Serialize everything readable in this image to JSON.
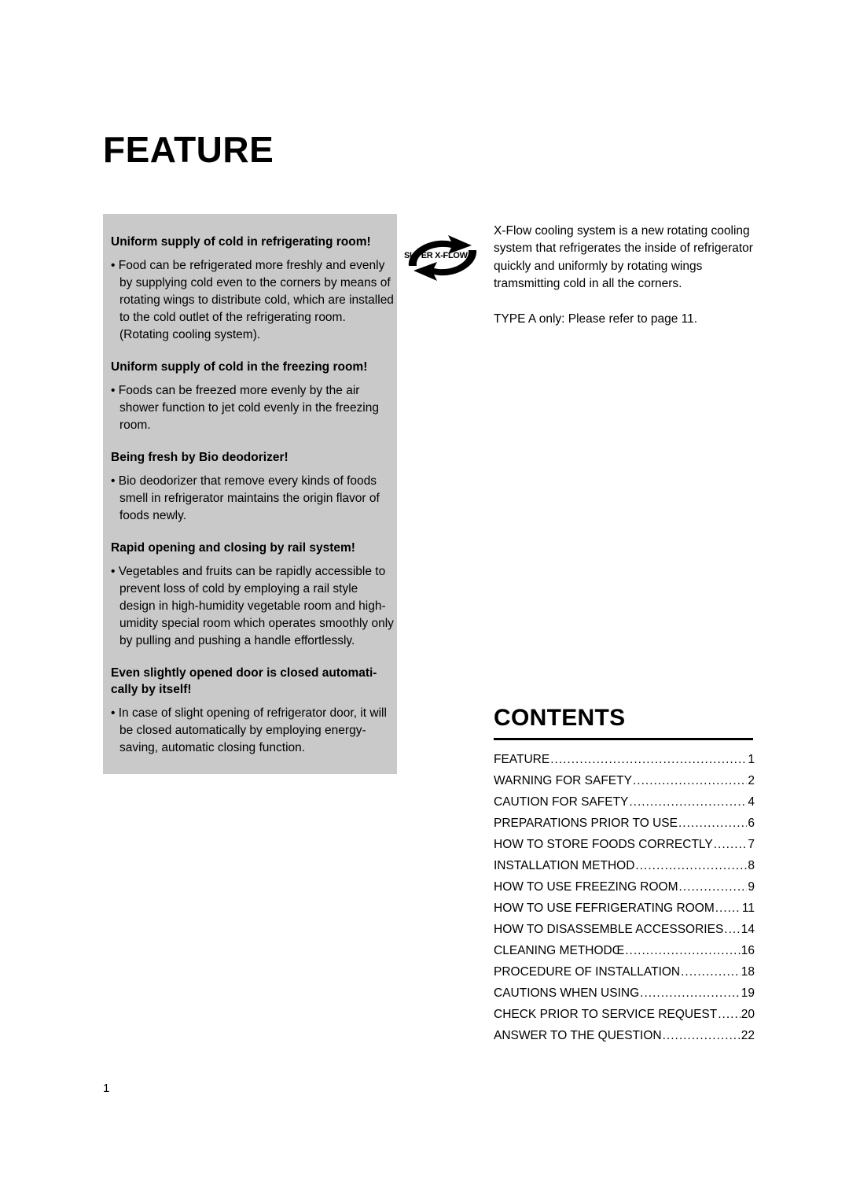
{
  "page": {
    "title": "FEATURE",
    "folio": "1"
  },
  "features": {
    "blocks": [
      {
        "heading": "Uniform supply of cold in refrigerating room!",
        "bullets": [
          "Food can be refrigerated more freshly and evenly by supplying cold even to the corners by means of rotating wings to distribute cold, which are installed to the cold outlet of the refrigerating room. (Rotating cooling system)."
        ]
      },
      {
        "heading": "Uniform supply of cold in the freezing room!",
        "bullets": [
          "Foods can be freezed more evenly by the air shower function to jet cold evenly in the freezing room."
        ]
      },
      {
        "heading": "Being fresh by Bio deodorizer!",
        "bullets": [
          "Bio deodorizer that remove every kinds of foods smell in refrigerator maintains the origin flavor of foods newly."
        ]
      },
      {
        "heading": "Rapid opening and closing by rail system!",
        "bullets": [
          "Vegetables and fruits can be rapidly accessible to prevent loss of cold by employing a rail style design in high-humidity vegetable room and high-umidity special room which operates smoothly only by pulling and pushing a handle effortlessly."
        ]
      },
      {
        "heading": "Even slightly opened door is closed automati- cally by itself!",
        "bullets": [
          "In case of slight opening of refrigerator door, it will be closed automatically by employing energy-saving, automatic closing function."
        ]
      }
    ]
  },
  "xflow": {
    "logo_label": "SUPER X-FLOW",
    "paragraph1": "X-Flow cooling system is a new rotating cooling system that refrigerates the inside of refrigerator quickly and uniformly by rotating wings tramsmitting cold in all the corners.",
    "paragraph2": "TYPE A only: Please refer to page 11."
  },
  "contents": {
    "title": "CONTENTS",
    "entries": [
      {
        "label": "FEATURE",
        "page": "1"
      },
      {
        "label": "WARNING FOR SAFETY",
        "page": "2"
      },
      {
        "label": "CAUTION FOR SAFETY",
        "page": "4"
      },
      {
        "label": "PREPARATIONS PRIOR TO USE",
        "page": "6"
      },
      {
        "label": "HOW TO STORE FOODS CORRECTLY",
        "page": "7"
      },
      {
        "label": "INSTALLATION METHOD",
        "page": "8"
      },
      {
        "label": "HOW TO USE FREEZING ROOM",
        "page": "9"
      },
      {
        "label": "HOW TO USE FEFRIGERATING ROOM",
        "page": "11"
      },
      {
        "label": "HOW TO DISASSEMBLE ACCESSORIES",
        "page": "14"
      },
      {
        "label": "CLEANING METHODŒ",
        "page": "16"
      },
      {
        "label": "PROCEDURE OF INSTALLATION",
        "page": "18"
      },
      {
        "label": "CAUTIONS WHEN USING",
        "page": "19"
      },
      {
        "label": "CHECK PRIOR TO SERVICE REQUEST",
        "page": "20"
      },
      {
        "label": "ANSWER TO THE QUESTION",
        "page": "22"
      }
    ]
  },
  "colors": {
    "panel_background": "#c9c9c9",
    "text": "#000000",
    "page_background": "#ffffff"
  }
}
